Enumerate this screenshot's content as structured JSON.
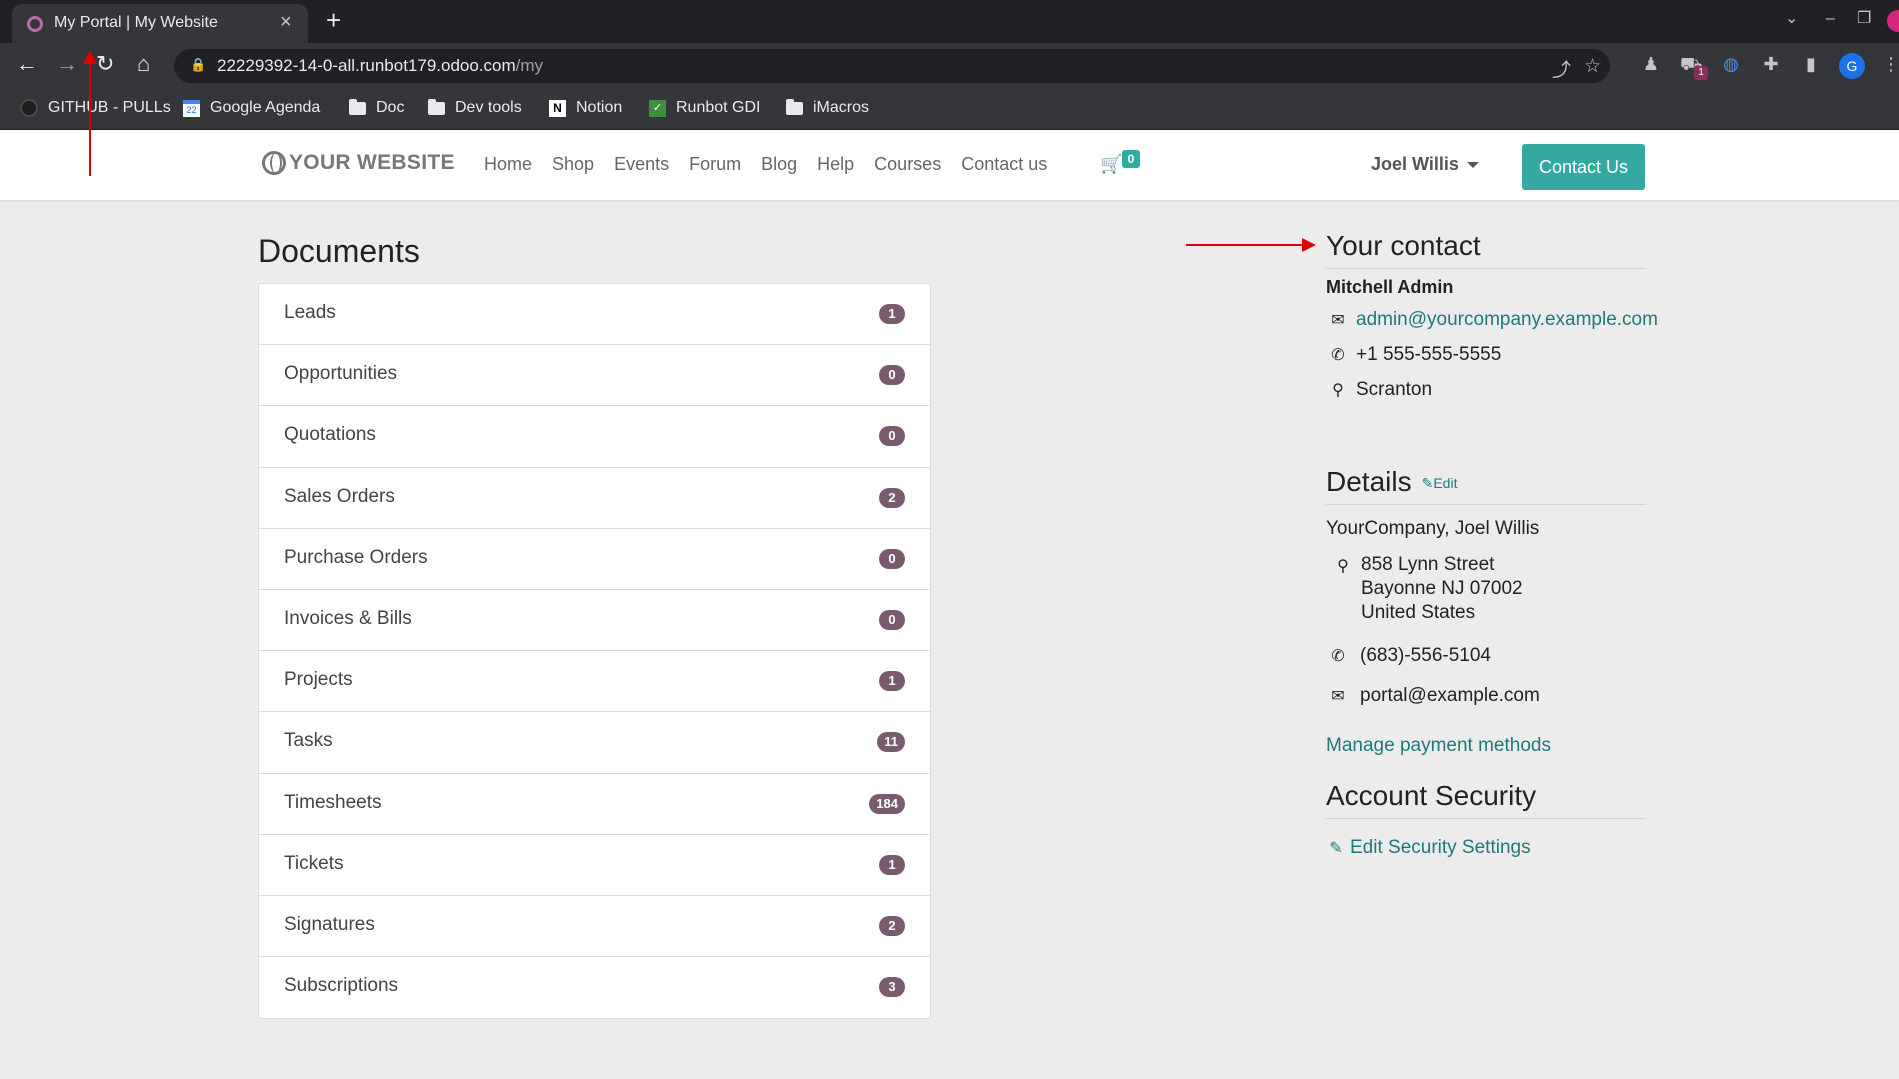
{
  "browser": {
    "tab_title": "My Portal | My Website",
    "url_host": "22229392-14-0-all.runbot179.odoo.com",
    "url_path": "/my",
    "profile_initial": "G",
    "extension_badge": "1",
    "bookmarks": [
      {
        "label": "GITHUB - PULLs",
        "icon": "github-icon"
      },
      {
        "label": "Google Agenda",
        "icon": "calendar-icon"
      },
      {
        "label": "Doc",
        "icon": "folder-icon"
      },
      {
        "label": "Dev tools",
        "icon": "folder-icon"
      },
      {
        "label": "Notion",
        "icon": "notion-icon"
      },
      {
        "label": "Runbot GDI",
        "icon": "runbot-icon"
      },
      {
        "label": "iMacros",
        "icon": "folder-icon"
      }
    ]
  },
  "header": {
    "logo_text": "YOUR WEBSITE",
    "nav": [
      "Home",
      "Shop",
      "Events",
      "Forum",
      "Blog",
      "Help",
      "Courses",
      "Contact us"
    ],
    "cart_count": "0",
    "user_name": "Joel Willis",
    "contact_button": "Contact Us"
  },
  "documents": {
    "title": "Documents",
    "items": [
      {
        "label": "Leads",
        "count": "1"
      },
      {
        "label": "Opportunities",
        "count": "0"
      },
      {
        "label": "Quotations",
        "count": "0"
      },
      {
        "label": "Sales Orders",
        "count": "2"
      },
      {
        "label": "Purchase Orders",
        "count": "0"
      },
      {
        "label": "Invoices & Bills",
        "count": "0"
      },
      {
        "label": "Projects",
        "count": "1"
      },
      {
        "label": "Tasks",
        "count": "11"
      },
      {
        "label": "Timesheets",
        "count": "184"
      },
      {
        "label": "Tickets",
        "count": "1"
      },
      {
        "label": "Signatures",
        "count": "2"
      },
      {
        "label": "Subscriptions",
        "count": "3"
      }
    ]
  },
  "your_contact": {
    "title": "Your contact",
    "name": "Mitchell Admin",
    "email": "admin@yourcompany.example.com",
    "phone": "+1 555-555-5555",
    "city": "Scranton"
  },
  "details": {
    "title": "Details",
    "edit_label": "Edit",
    "company": "YourCompany, Joel Willis",
    "address_line1": "858 Lynn Street",
    "address_line2": "Bayonne NJ 07002",
    "address_line3": "United States",
    "phone": "(683)-556-5104",
    "email": "portal@example.com",
    "manage_payment": "Manage payment methods"
  },
  "security": {
    "title": "Account Security",
    "edit_settings": "Edit Security Settings"
  },
  "colors": {
    "accent": "#35a9a1",
    "badge": "#7a5b6e",
    "link": "#1d7a76",
    "annotation": "#e10000"
  }
}
